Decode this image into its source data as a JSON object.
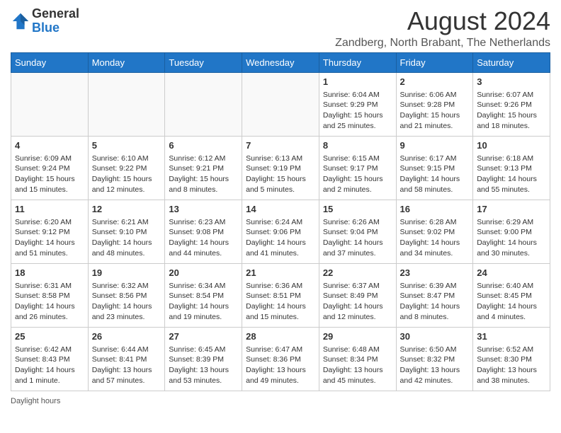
{
  "logo": {
    "general": "General",
    "blue": "Blue"
  },
  "header": {
    "month_year": "August 2024",
    "location": "Zandberg, North Brabant, The Netherlands"
  },
  "weekdays": [
    "Sunday",
    "Monday",
    "Tuesday",
    "Wednesday",
    "Thursday",
    "Friday",
    "Saturday"
  ],
  "weeks": [
    [
      {
        "day": "",
        "info": ""
      },
      {
        "day": "",
        "info": ""
      },
      {
        "day": "",
        "info": ""
      },
      {
        "day": "",
        "info": ""
      },
      {
        "day": "1",
        "info": "Sunrise: 6:04 AM\nSunset: 9:29 PM\nDaylight: 15 hours and 25 minutes."
      },
      {
        "day": "2",
        "info": "Sunrise: 6:06 AM\nSunset: 9:28 PM\nDaylight: 15 hours and 21 minutes."
      },
      {
        "day": "3",
        "info": "Sunrise: 6:07 AM\nSunset: 9:26 PM\nDaylight: 15 hours and 18 minutes."
      }
    ],
    [
      {
        "day": "4",
        "info": "Sunrise: 6:09 AM\nSunset: 9:24 PM\nDaylight: 15 hours and 15 minutes."
      },
      {
        "day": "5",
        "info": "Sunrise: 6:10 AM\nSunset: 9:22 PM\nDaylight: 15 hours and 12 minutes."
      },
      {
        "day": "6",
        "info": "Sunrise: 6:12 AM\nSunset: 9:21 PM\nDaylight: 15 hours and 8 minutes."
      },
      {
        "day": "7",
        "info": "Sunrise: 6:13 AM\nSunset: 9:19 PM\nDaylight: 15 hours and 5 minutes."
      },
      {
        "day": "8",
        "info": "Sunrise: 6:15 AM\nSunset: 9:17 PM\nDaylight: 15 hours and 2 minutes."
      },
      {
        "day": "9",
        "info": "Sunrise: 6:17 AM\nSunset: 9:15 PM\nDaylight: 14 hours and 58 minutes."
      },
      {
        "day": "10",
        "info": "Sunrise: 6:18 AM\nSunset: 9:13 PM\nDaylight: 14 hours and 55 minutes."
      }
    ],
    [
      {
        "day": "11",
        "info": "Sunrise: 6:20 AM\nSunset: 9:12 PM\nDaylight: 14 hours and 51 minutes."
      },
      {
        "day": "12",
        "info": "Sunrise: 6:21 AM\nSunset: 9:10 PM\nDaylight: 14 hours and 48 minutes."
      },
      {
        "day": "13",
        "info": "Sunrise: 6:23 AM\nSunset: 9:08 PM\nDaylight: 14 hours and 44 minutes."
      },
      {
        "day": "14",
        "info": "Sunrise: 6:24 AM\nSunset: 9:06 PM\nDaylight: 14 hours and 41 minutes."
      },
      {
        "day": "15",
        "info": "Sunrise: 6:26 AM\nSunset: 9:04 PM\nDaylight: 14 hours and 37 minutes."
      },
      {
        "day": "16",
        "info": "Sunrise: 6:28 AM\nSunset: 9:02 PM\nDaylight: 14 hours and 34 minutes."
      },
      {
        "day": "17",
        "info": "Sunrise: 6:29 AM\nSunset: 9:00 PM\nDaylight: 14 hours and 30 minutes."
      }
    ],
    [
      {
        "day": "18",
        "info": "Sunrise: 6:31 AM\nSunset: 8:58 PM\nDaylight: 14 hours and 26 minutes."
      },
      {
        "day": "19",
        "info": "Sunrise: 6:32 AM\nSunset: 8:56 PM\nDaylight: 14 hours and 23 minutes."
      },
      {
        "day": "20",
        "info": "Sunrise: 6:34 AM\nSunset: 8:54 PM\nDaylight: 14 hours and 19 minutes."
      },
      {
        "day": "21",
        "info": "Sunrise: 6:36 AM\nSunset: 8:51 PM\nDaylight: 14 hours and 15 minutes."
      },
      {
        "day": "22",
        "info": "Sunrise: 6:37 AM\nSunset: 8:49 PM\nDaylight: 14 hours and 12 minutes."
      },
      {
        "day": "23",
        "info": "Sunrise: 6:39 AM\nSunset: 8:47 PM\nDaylight: 14 hours and 8 minutes."
      },
      {
        "day": "24",
        "info": "Sunrise: 6:40 AM\nSunset: 8:45 PM\nDaylight: 14 hours and 4 minutes."
      }
    ],
    [
      {
        "day": "25",
        "info": "Sunrise: 6:42 AM\nSunset: 8:43 PM\nDaylight: 14 hours and 1 minute."
      },
      {
        "day": "26",
        "info": "Sunrise: 6:44 AM\nSunset: 8:41 PM\nDaylight: 13 hours and 57 minutes."
      },
      {
        "day": "27",
        "info": "Sunrise: 6:45 AM\nSunset: 8:39 PM\nDaylight: 13 hours and 53 minutes."
      },
      {
        "day": "28",
        "info": "Sunrise: 6:47 AM\nSunset: 8:36 PM\nDaylight: 13 hours and 49 minutes."
      },
      {
        "day": "29",
        "info": "Sunrise: 6:48 AM\nSunset: 8:34 PM\nDaylight: 13 hours and 45 minutes."
      },
      {
        "day": "30",
        "info": "Sunrise: 6:50 AM\nSunset: 8:32 PM\nDaylight: 13 hours and 42 minutes."
      },
      {
        "day": "31",
        "info": "Sunrise: 6:52 AM\nSunset: 8:30 PM\nDaylight: 13 hours and 38 minutes."
      }
    ]
  ],
  "footer": {
    "daylight_label": "Daylight hours"
  }
}
